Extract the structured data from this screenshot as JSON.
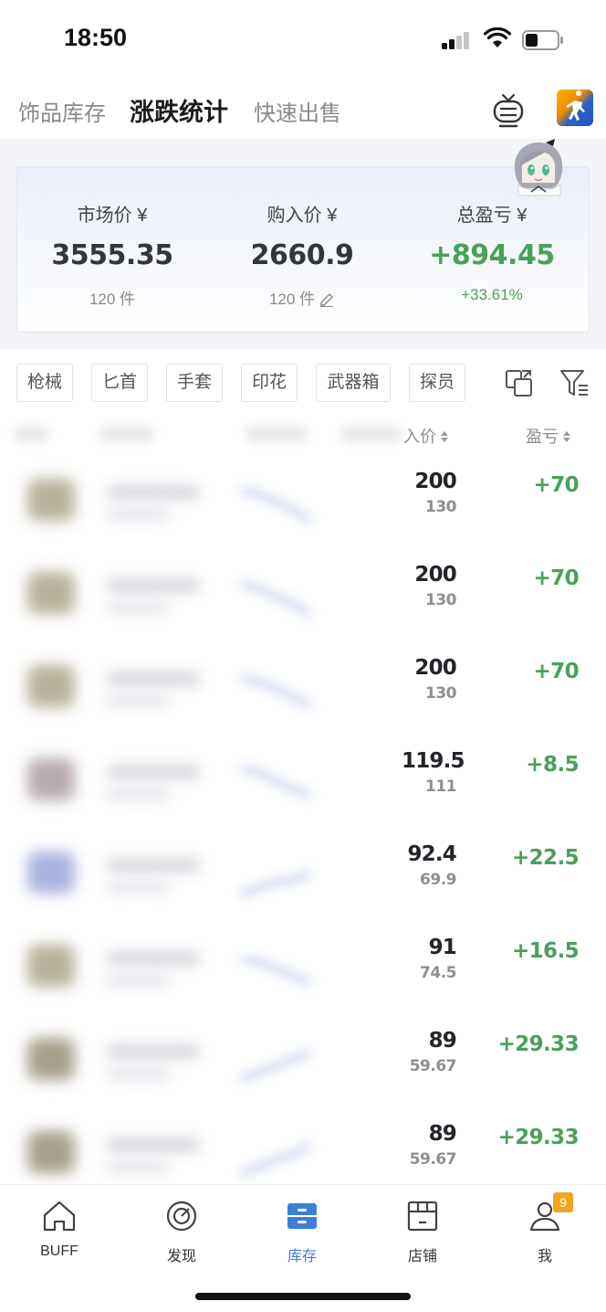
{
  "status_bar": {
    "time": "18:50"
  },
  "tabs": [
    {
      "label": "饰品库存",
      "active": false
    },
    {
      "label": "涨跌统计",
      "active": true
    },
    {
      "label": "快速出售",
      "active": false
    }
  ],
  "summary": {
    "market": {
      "label": "市场价 ¥",
      "value": "3555.35",
      "count": "120 件"
    },
    "purchase": {
      "label": "购入价 ¥",
      "value": "2660.9",
      "count": "120 件"
    },
    "profit": {
      "label": "总盈亏 ¥",
      "value": "+894.45",
      "percent": "+33.61%"
    }
  },
  "filters": [
    "枪械",
    "匕首",
    "手套",
    "印花",
    "武器箱",
    "探员"
  ],
  "table_header": {
    "price_col": "入价",
    "profit_col": "盈亏"
  },
  "rows": [
    {
      "price": "200",
      "buy_price": "130",
      "profit": "+70",
      "img_color": "#b8b09a"
    },
    {
      "price": "200",
      "buy_price": "130",
      "profit": "+70",
      "img_color": "#b8b09a"
    },
    {
      "price": "200",
      "buy_price": "130",
      "profit": "+70",
      "img_color": "#b8b09a"
    },
    {
      "price": "119.5",
      "buy_price": "111",
      "profit": "+8.5",
      "img_color": "#b7aab0"
    },
    {
      "price": "92.4",
      "buy_price": "69.9",
      "profit": "+22.5",
      "img_color": "#a9b2dc"
    },
    {
      "price": "91",
      "buy_price": "74.5",
      "profit": "+16.5",
      "img_color": "#b8b09a"
    },
    {
      "price": "89",
      "buy_price": "59.67",
      "profit": "+29.33",
      "img_color": "#a89f8c"
    },
    {
      "price": "89",
      "buy_price": "59.67",
      "profit": "+29.33",
      "img_color": "#a89f8c"
    }
  ],
  "bottom_nav": [
    {
      "label": "BUFF",
      "icon": "home-icon",
      "active": false
    },
    {
      "label": "发现",
      "icon": "discover-icon",
      "active": false
    },
    {
      "label": "库存",
      "icon": "inventory-icon",
      "active": true
    },
    {
      "label": "店铺",
      "icon": "store-icon",
      "active": false
    },
    {
      "label": "我",
      "icon": "profile-icon",
      "active": false,
      "badge": "9"
    }
  ],
  "colors": {
    "positive": "#4aa05a",
    "accent": "#3c7fd6",
    "badge": "#f0a423"
  }
}
